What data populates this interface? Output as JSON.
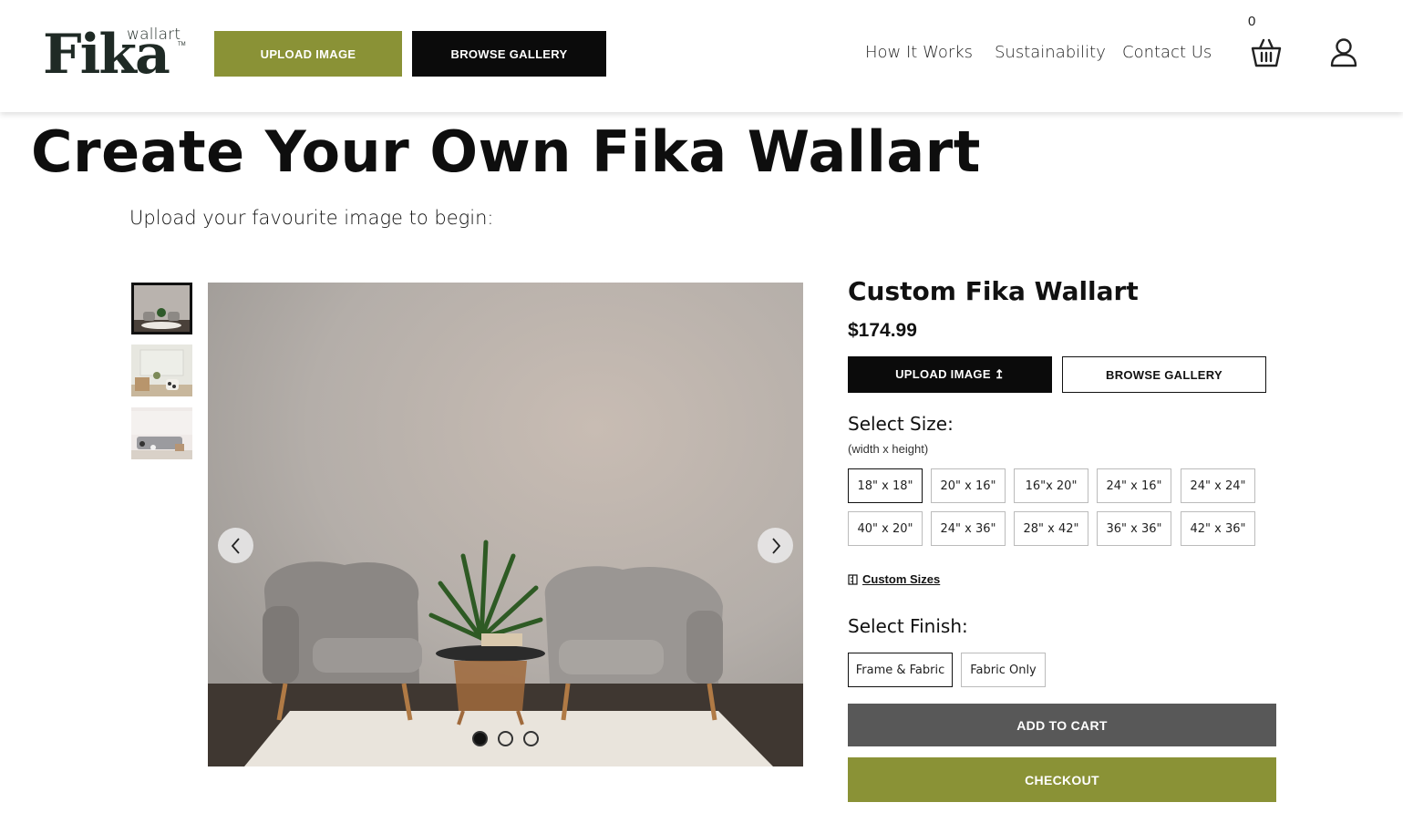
{
  "header": {
    "logo_small": "wallart",
    "logo_main": "Fika",
    "logo_tm": "TM",
    "upload_label": "UPLOAD IMAGE",
    "browse_label": "BROWSE GALLERY",
    "nav": [
      "How It Works",
      "Sustainability",
      "Contact Us"
    ],
    "cart_count": "0",
    "brand_color": "#8a9236"
  },
  "main": {
    "title": "Create Your Own Fika Wallart",
    "subtitle": "Upload your favourite image to begin:"
  },
  "product": {
    "name": "Custom Fika Wallart",
    "price": "$174.99",
    "upload_label": "UPLOAD IMAGE",
    "upload_icon": "↥",
    "browse_label": "BROWSE GALLERY",
    "size_label": "Select Size:",
    "size_note": "(width x height)",
    "sizes": [
      "18\" x 18\"",
      "20\" x 16\"",
      "16\"x 20\"",
      "24\" x 16\"",
      "24\" x 24\"",
      "40\" x 20\"",
      "24\" x 36\"",
      "28\" x 42\"",
      "36\" x 36\"",
      "42\" x 36\""
    ],
    "selected_size": "18\" x 18\"",
    "custom_sizes_label": "Custom Sizes",
    "finish_label": "Select Finish:",
    "finishes": [
      "Frame & Fabric",
      "Fabric Only"
    ],
    "selected_finish": "Frame & Fabric",
    "add_to_cart": "ADD TO CART",
    "checkout": "CHECKOUT"
  },
  "gallery": {
    "slide_count": 3,
    "active_slide": 1
  }
}
